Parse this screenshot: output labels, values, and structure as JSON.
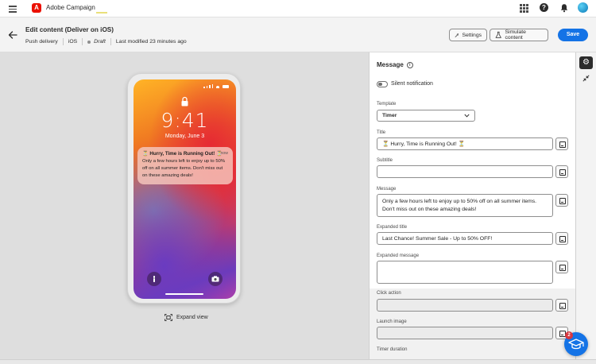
{
  "app": {
    "name": "Adobe Campaign",
    "logo_letter": "A",
    "brand_color": "#eb1000",
    "accent_color": "#1473e6"
  },
  "topbar": {
    "icons": [
      "menu-icon",
      "apps-grid-icon",
      "help-icon",
      "bell-icon",
      "avatar"
    ],
    "help_glyph": "?"
  },
  "header": {
    "title": "Edit content (Deliver on iOS)",
    "channel": "Push delivery",
    "platform": "iOS",
    "status": "Draft",
    "last_modified": "Last modified 23 minutes ago",
    "settings_label": "Settings",
    "simulate_label": "Simulate content",
    "save_label": "Save"
  },
  "preview": {
    "time": "9:41",
    "date": "Monday, June 3",
    "notification": {
      "title": "⏳ Hurry, Time is Running Out! ⏳",
      "time": "now",
      "body": "Only a few hours left to enjoy up to 50% off on all summer items. Don't miss out on these amazing deals!"
    },
    "expand_label": "Expand view"
  },
  "panel": {
    "title": "Message",
    "info_glyph": "i",
    "silent_label": "Silent notification",
    "silent_on": false,
    "template_label": "Template",
    "template_value": "Timer",
    "title_label": "Title",
    "title_value": "⏳ Hurry, Time is Running Out! ⏳",
    "subtitle_label": "Subtitle",
    "subtitle_value": "",
    "message_label": "Message",
    "message_value": "Only a few hours left to enjoy up to 50% off on all summer items. Don't miss out on these amazing deals!",
    "expanded_title_label": "Expanded title",
    "expanded_title_value": "Last Chance! Summer Sale - Up to 50% OFF!",
    "expanded_message_label": "Expanded message",
    "expanded_message_value": "",
    "click_action_label": "Click action",
    "click_action_value": "",
    "launch_image_label": "Launch image",
    "launch_image_value": "",
    "timer_duration_label": "Timer duration"
  },
  "rail": {
    "gear_glyph": "⚙"
  },
  "help_fab": {
    "badge": "2"
  }
}
